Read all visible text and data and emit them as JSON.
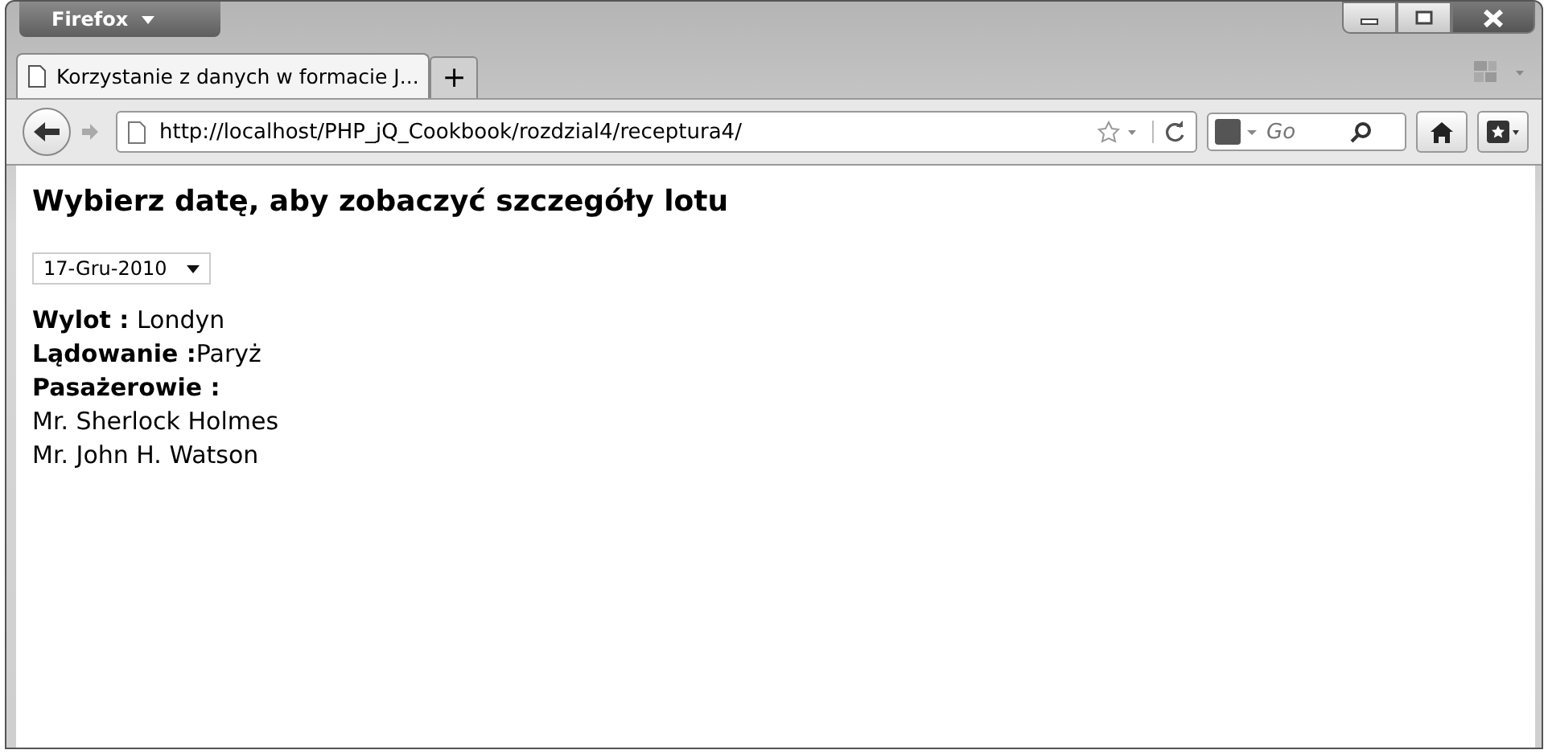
{
  "browser": {
    "menu_button": "Firefox",
    "tab": {
      "title": "Korzystanie z danych w formacie J...",
      "selected": true
    },
    "new_tab": "+",
    "url": "http://localhost/PHP_jQ_Cookbook/rozdzial4/receptura4/",
    "search": {
      "placeholder": "Go"
    }
  },
  "page": {
    "heading": "Wybierz datę, aby zobaczyć szczegóły lotu",
    "date_select": {
      "value": "17-Gru-2010"
    },
    "details": [
      "**Wylot :** Londyn",
      "**Lądowanie :**Paryż",
      "**Pasażerowie :**",
      "Mr. Sherlock Holmes",
      "Mr. John H. Watson"
    ]
  }
}
